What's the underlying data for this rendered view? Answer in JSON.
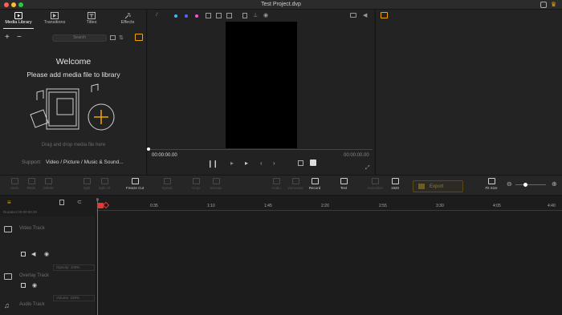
{
  "window": {
    "title": "Test Project.dvp"
  },
  "colors": {
    "accent": "#f0a500",
    "playhead": "#e53935",
    "traffic_close": "#ff5f57",
    "traffic_min": "#febc2e",
    "traffic_max": "#28c840"
  },
  "tabs": [
    {
      "label": "Media Library",
      "icon": "media-library-icon",
      "active": true
    },
    {
      "label": "Transitions",
      "icon": "transitions-icon",
      "active": false
    },
    {
      "label": "Titles",
      "icon": "titles-icon",
      "active": false
    },
    {
      "label": "Effects",
      "icon": "effects-icon",
      "active": false
    }
  ],
  "library": {
    "search_placeholder": "Search",
    "welcome_title": "Welcome",
    "welcome_subtitle": "Please add media file to library",
    "drag_hint": "Drag and drop media file here",
    "support_label": "Support:",
    "support_value": "Video / Picture / Music & Sound..."
  },
  "preview": {
    "time_current": "00:00:00.00",
    "time_total": "00:00:00.00"
  },
  "toolbar": {
    "items": [
      {
        "label": "Undo",
        "enabled": false
      },
      {
        "label": "Redo",
        "enabled": false
      },
      {
        "label": "Delete",
        "enabled": false
      },
      {
        "label": "Split",
        "enabled": false
      },
      {
        "label": "Split All",
        "enabled": false
      },
      {
        "label": "Freeze Cut",
        "enabled": true
      },
      {
        "label": "Speed",
        "enabled": false
      },
      {
        "label": "Crop",
        "enabled": false
      },
      {
        "label": "Mosaic",
        "enabled": false
      },
      {
        "label": "Audio",
        "enabled": false
      },
      {
        "label": "Voiceover",
        "enabled": false
      },
      {
        "label": "Record",
        "enabled": true
      },
      {
        "label": "Text",
        "enabled": true
      },
      {
        "label": "Animation",
        "enabled": false
      },
      {
        "label": "1920",
        "enabled": true
      },
      {
        "label": "Fit Size",
        "enabled": true
      }
    ],
    "export_label": "Export"
  },
  "timeline": {
    "duration_label": "Duration:00:00:00.00",
    "ruler": [
      "0",
      "0:35",
      "1:10",
      "1:45",
      "2:20",
      "2:55",
      "3:30",
      "4:05",
      "4:40"
    ],
    "tracks": [
      {
        "name": "Video Track",
        "opacity_label": "Opacity: 100%"
      },
      {
        "name": "Overlay Track"
      },
      {
        "name": "Audio Track",
        "volume_label": "Volume: 100%"
      }
    ]
  }
}
